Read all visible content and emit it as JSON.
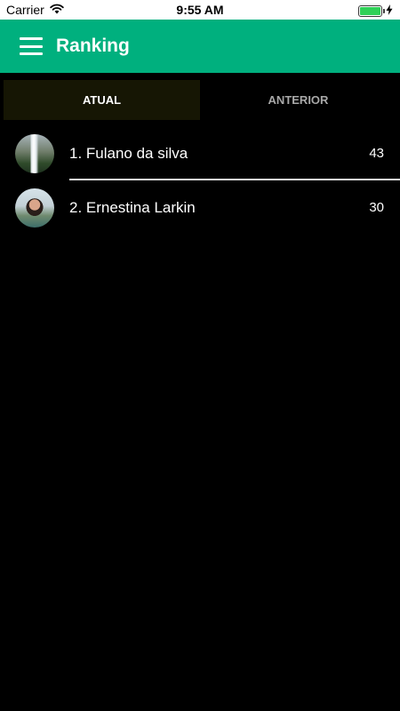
{
  "status_bar": {
    "carrier": "Carrier",
    "time": "9:55 AM",
    "battery_level": 1.0
  },
  "app_bar": {
    "title": "Ranking",
    "menu_icon": "hamburger-menu-icon",
    "background_color": "#00b07e"
  },
  "tabs": [
    {
      "label": "ATUAL",
      "active": true
    },
    {
      "label": "ANTERIOR",
      "active": false
    }
  ],
  "ranking": [
    {
      "name": "1. Fulano da silva",
      "score": "43",
      "avatar": "waterfall-photo"
    },
    {
      "name": "2. Ernestina Larkin",
      "score": "30",
      "avatar": "woman-portrait-photo"
    }
  ]
}
